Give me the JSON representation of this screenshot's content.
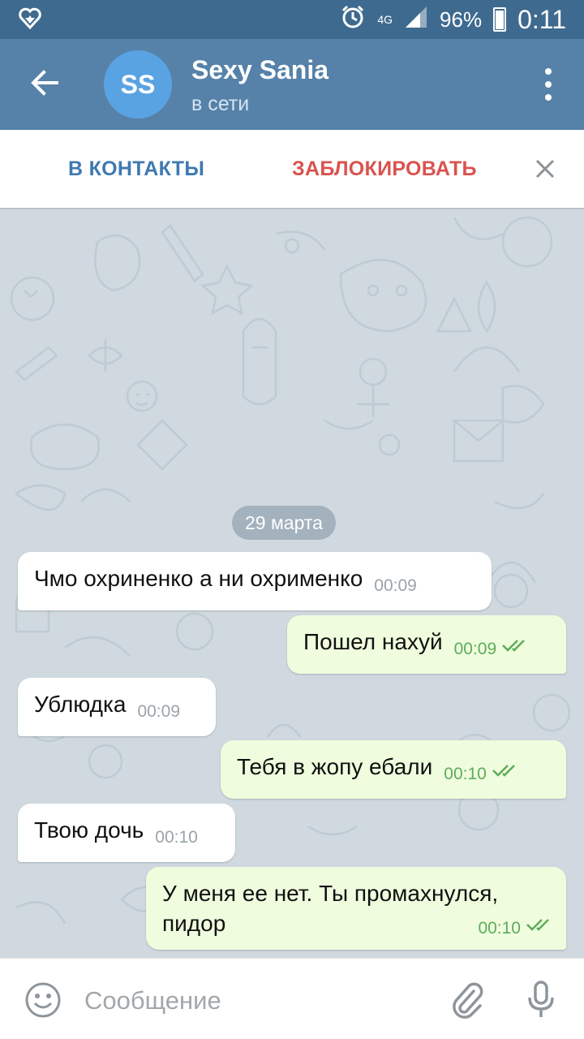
{
  "status_bar": {
    "network": "4G",
    "battery": "96%",
    "battery_level": 0.96,
    "time": "0:11",
    "icons": [
      "heart-icon",
      "alarm-icon",
      "signal-icon",
      "battery-icon"
    ]
  },
  "header": {
    "avatar_initials": "SS",
    "title": "Sexy Sania",
    "subtitle": "в сети"
  },
  "action_bar": {
    "add_contact": "В КОНТАКТЫ",
    "block": "ЗАБЛОКИРОВАТЬ"
  },
  "chat": {
    "date": "29 марта",
    "messages": [
      {
        "dir": "in",
        "text": "Чмо охриненко а ни охрименко",
        "time": "00:09"
      },
      {
        "dir": "out",
        "text": "Пошел нахуй",
        "time": "00:09"
      },
      {
        "dir": "in",
        "text": "Ублюдка",
        "time": "00:09"
      },
      {
        "dir": "out",
        "text": "Тебя в жопу ебали",
        "time": "00:10"
      },
      {
        "dir": "in",
        "text": "Твою дочь",
        "time": "00:10"
      },
      {
        "dir": "out",
        "text": "У меня ее нет. Ты промахнулся, пидор",
        "time": "00:10"
      }
    ]
  },
  "input": {
    "placeholder": "Сообщение"
  },
  "colors": {
    "status_bar": "#3f6a8f",
    "header": "#5682a9",
    "avatar": "#5aa3e3",
    "contacts_action": "#3f79b0",
    "block_action": "#d9534f",
    "chat_background": "#cfd9df",
    "outgoing_bubble": "#effdde",
    "incoming_bubble": "#ffffff"
  }
}
